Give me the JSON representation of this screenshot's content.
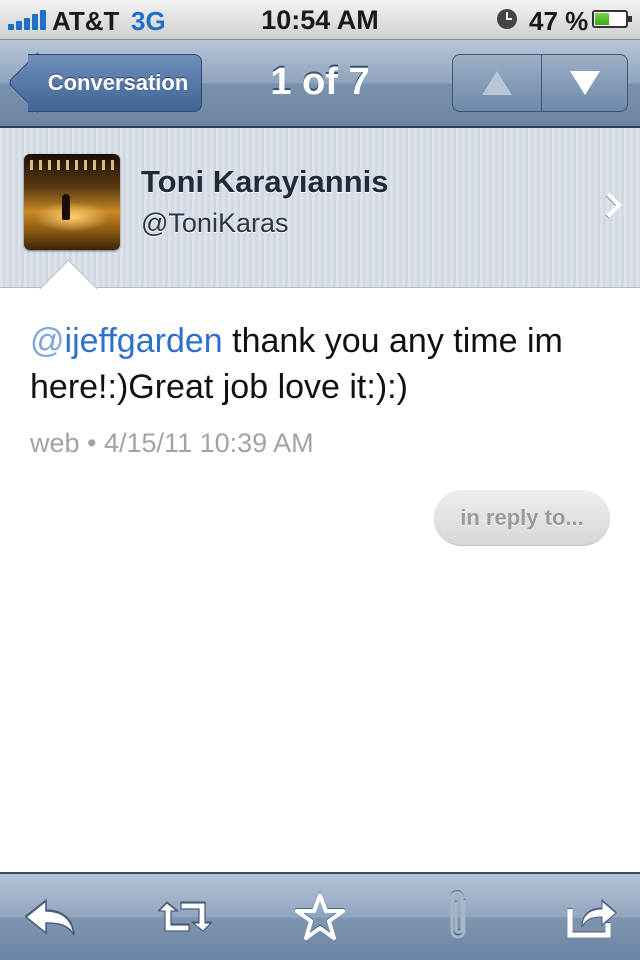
{
  "status_bar": {
    "carrier": "AT&T",
    "network": "3G",
    "time": "10:54 AM",
    "battery_percent": "47 %",
    "battery_level": 0.47
  },
  "nav": {
    "back_label": "Conversation",
    "title": "1 of 7"
  },
  "user": {
    "name": "Toni Karayiannis",
    "handle": "@ToniKaras"
  },
  "tweet": {
    "mention_at": "@",
    "mention_name": "ijeffgarden",
    "text": " thank you any time im here!:)Great job love it:):)",
    "source": "web",
    "separator": " • ",
    "timestamp": "4/15/11 10:39 AM"
  },
  "in_reply_to_label": "in reply to...",
  "toolbar": {
    "icons": [
      "reply-icon",
      "retweet-icon",
      "favorite-icon",
      "attachment-icon",
      "share-icon"
    ]
  }
}
